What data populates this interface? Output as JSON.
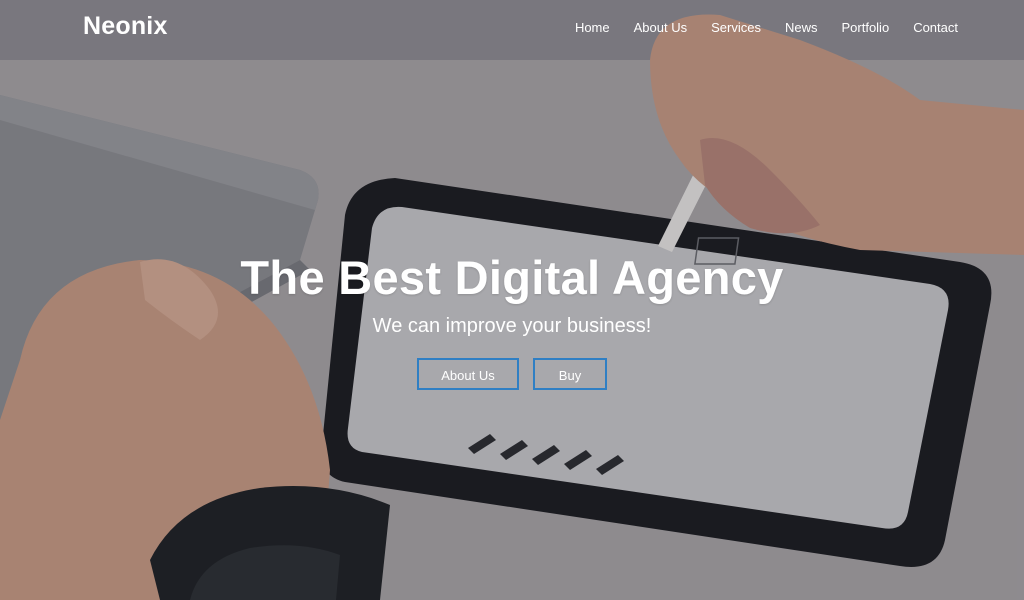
{
  "brand": {
    "logo_text": "Neonix"
  },
  "nav": {
    "items": [
      {
        "label": "Home"
      },
      {
        "label": "About Us"
      },
      {
        "label": "Services"
      },
      {
        "label": "News"
      },
      {
        "label": "Portfolio"
      },
      {
        "label": "Contact"
      }
    ]
  },
  "hero": {
    "title": "The Best Digital Agency",
    "subtitle": "We can improve your business!",
    "buttons": {
      "about_label": "About Us",
      "buy_label": "Buy"
    }
  },
  "colors": {
    "button_border": "#2f7fc4",
    "text": "#ffffff"
  }
}
